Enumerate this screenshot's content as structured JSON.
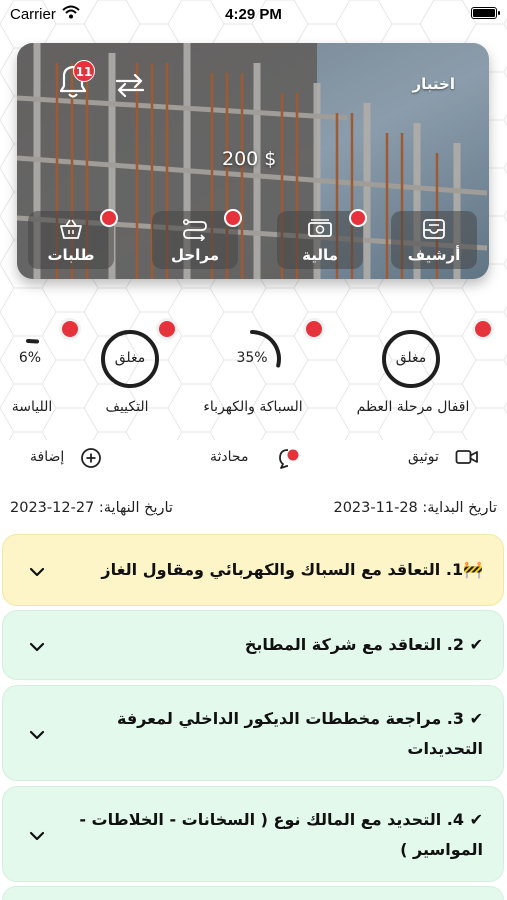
{
  "status": {
    "carrier": "Carrier",
    "time": "4:29 PM"
  },
  "hero": {
    "label": "اختبار",
    "amount": "200 $",
    "notification_count": "11",
    "tiles": [
      {
        "label": "أرشيف",
        "icon": "archive-tray-icon"
      },
      {
        "label": "مالية",
        "icon": "cash-icon"
      },
      {
        "label": "مراحل",
        "icon": "route-icon"
      },
      {
        "label": "طلبات",
        "icon": "basket-icon"
      }
    ]
  },
  "stages": [
    {
      "title": "اقفال مرحلة العظم",
      "value_label": "مغلق",
      "progress": 1.0
    },
    {
      "title": "السباكة والكهرباء",
      "value_label": "35%",
      "progress": 0.35
    },
    {
      "title": "التكييف",
      "value_label": "مغلق",
      "progress": 1.0
    },
    {
      "title": "اللياسة",
      "value_label": "6%",
      "progress": 0.06
    }
  ],
  "actions": {
    "document": "توثيق",
    "chat": "محادثة",
    "add": "إضافة"
  },
  "dates": {
    "start": "تاريخ البداية: 28-11-2023",
    "end": "تاريخ النهاية: 27-12-2023"
  },
  "tasks": [
    {
      "text": "🚧1. التعاقد مع السباك والكهربائي ومقاول الغاز",
      "status": "pending"
    },
    {
      "text": "✔ 2. التعاقد مع شركة المطابخ",
      "status": "done"
    },
    {
      "text": "✔ 3. مراجعة مخططات الديكور الداخلي لمعرفة التحديدات",
      "status": "done"
    },
    {
      "text": "✔ 4. التحديد مع المالك نوع ( السخانات - الخلاطات - المواسير )",
      "status": "done"
    }
  ],
  "colors": {
    "red_dot": "#e5323b",
    "pending_bg": "#fdf5c7",
    "done_bg": "#e3f9ec",
    "ring": "#1f1f1f"
  }
}
